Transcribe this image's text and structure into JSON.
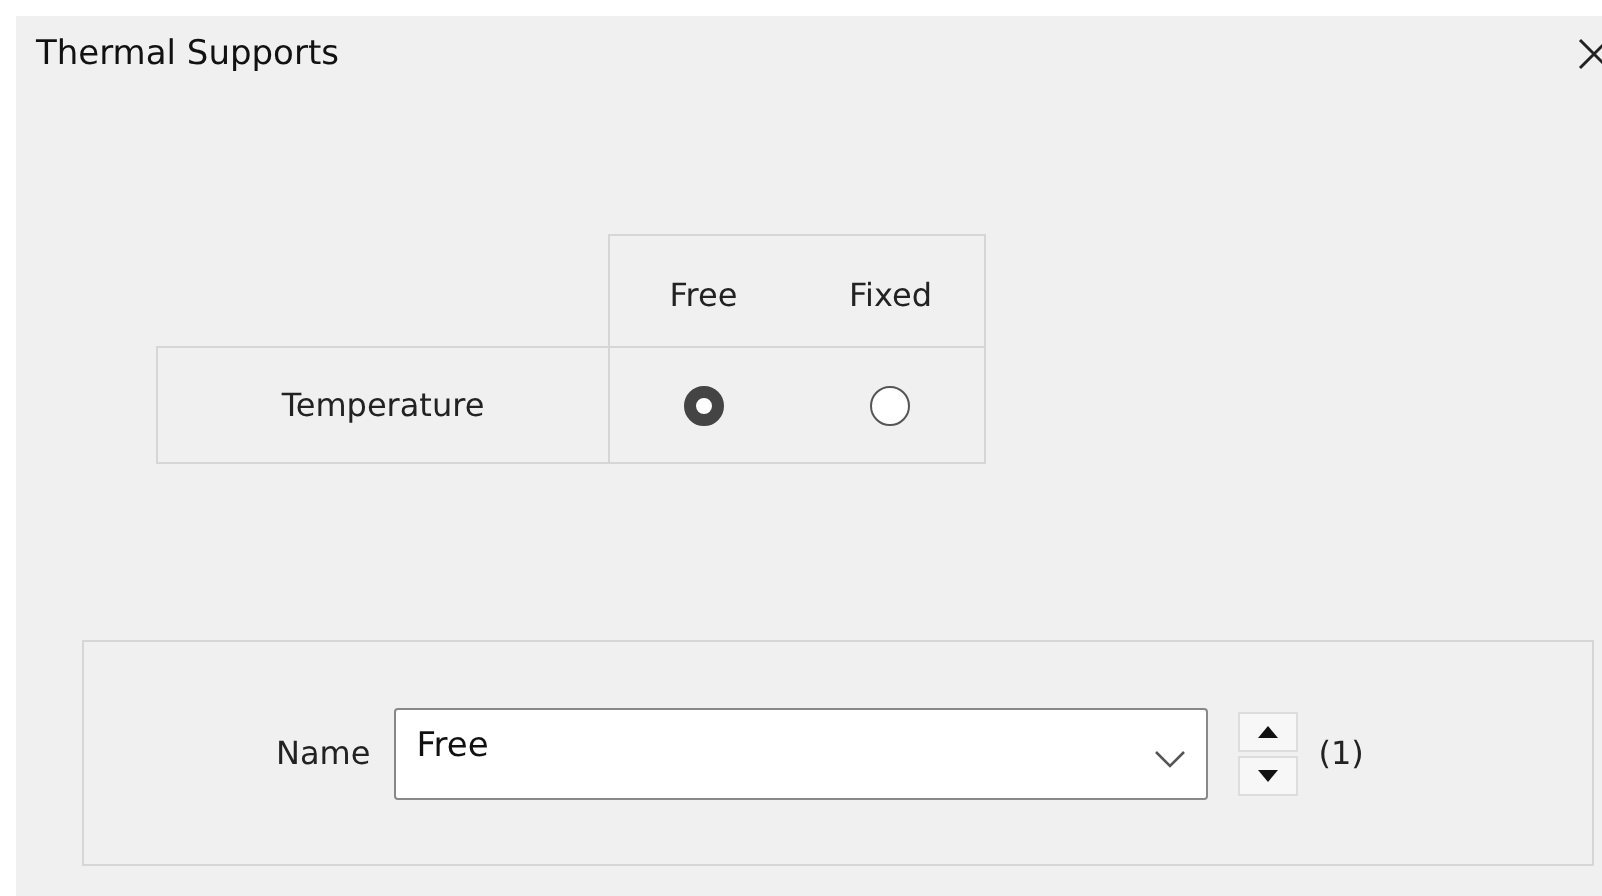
{
  "window": {
    "title": "Thermal Supports"
  },
  "grid": {
    "columns": [
      "Free",
      "Fixed"
    ],
    "rows": [
      {
        "label": "Temperature",
        "options": [
          {
            "selected": true
          },
          {
            "selected": false
          }
        ]
      }
    ]
  },
  "name_field": {
    "label": "Name",
    "value": "Free",
    "count": "(1)"
  }
}
